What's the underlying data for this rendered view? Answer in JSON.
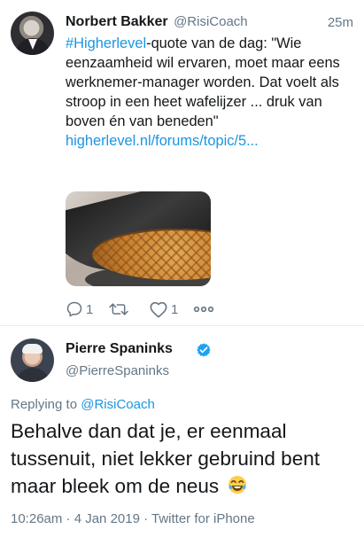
{
  "tweet1": {
    "author_name": "Norbert Bakker",
    "author_handle": "@RisiCoach",
    "time": "25m",
    "hashtag": "#Higherlevel",
    "text_after_hashtag": "-quote van de dag: \"Wie eenzaamheid wil ervaren, moet maar eens werknemer-manager worden. Dat voelt als stroop in een heet wafelijzer ... druk van boven én van beneden\"",
    "link": "higherlevel.nl/forums/topic/5...",
    "reply_count": "1",
    "like_count": "1"
  },
  "tweet2": {
    "author_name": "Pierre Spaninks",
    "author_handle": "@PierreSpaninks",
    "replying_to_label": "Replying to ",
    "replying_to_user": "@RisiCoach",
    "text": "Behalve dan dat je, er eenmaal tussenuit, niet lekker gebruind bent maar bleek om de neus",
    "meta": "10:26am · 4 Jan 2019 · Twitter for iPhone"
  },
  "colors": {
    "accent": "#1b95e0",
    "secondary_text": "#657786",
    "primary_text": "#14171a",
    "divider": "#e6ecf0"
  },
  "icons": {
    "reply": "reply-icon",
    "retweet": "retweet-icon",
    "like": "heart-icon",
    "more": "more-icon",
    "verified": "verified-badge-icon",
    "emoji": "laughing-tears-emoji"
  }
}
